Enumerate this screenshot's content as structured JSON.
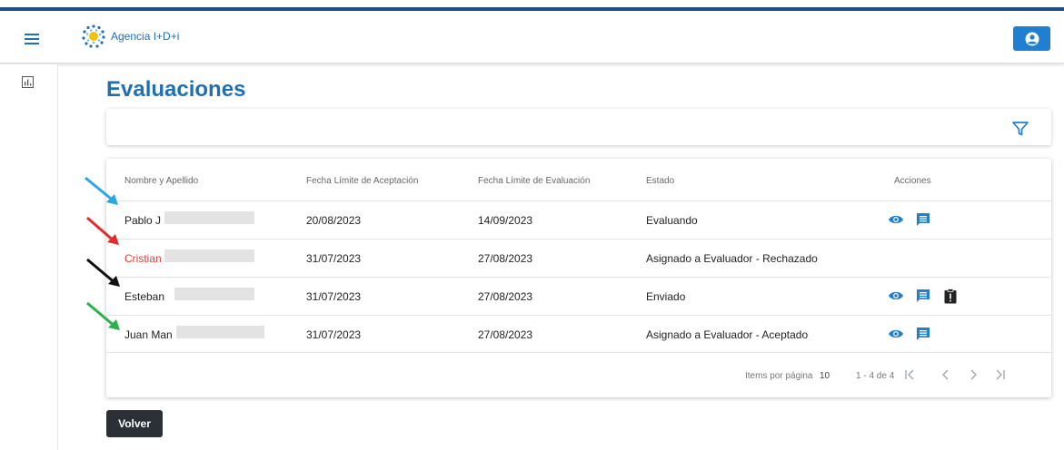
{
  "header": {
    "logo_text": "Agencia I+D+i",
    "menu_icon": "hamburger-menu-icon",
    "user_icon": "user-circle-icon",
    "accent": "#1f6fb5"
  },
  "sidebar": {
    "items": [
      {
        "icon": "bar-chart-icon"
      }
    ]
  },
  "page": {
    "title": "Evaluaciones"
  },
  "filter": {
    "icon": "filter-icon"
  },
  "table": {
    "headers": {
      "name": "Nombre y Apellido",
      "accept_deadline": "Fecha Límite de Aceptación",
      "eval_deadline": "Fecha Límite de Evaluación",
      "status": "Estado",
      "actions": "Acciones"
    },
    "rows": [
      {
        "name": "Pablo J",
        "accept_deadline": "20/08/2023",
        "eval_deadline": "14/09/2023",
        "status": "Evaluando",
        "name_color": "#222222",
        "actions": [
          "eye-icon",
          "comment-icon"
        ]
      },
      {
        "name": "Cristian",
        "accept_deadline": "31/07/2023",
        "eval_deadline": "27/08/2023",
        "status": "Asignado a Evaluador - Rechazado",
        "name_color": "#e53935",
        "actions": []
      },
      {
        "name": "Esteban",
        "accept_deadline": "31/07/2023",
        "eval_deadline": "27/08/2023",
        "status": "Enviado",
        "name_color": "#222222",
        "actions": [
          "eye-icon",
          "comment-icon",
          "clipboard-alert-icon"
        ]
      },
      {
        "name": "Juan Man",
        "accept_deadline": "31/07/2023",
        "eval_deadline": "27/08/2023",
        "status": "Asignado a Evaluador - Aceptado",
        "name_color": "#222222",
        "actions": [
          "eye-icon",
          "comment-icon"
        ]
      }
    ]
  },
  "pagination": {
    "items_per_page_label": "Items por página",
    "items_per_page_value": "10",
    "range": "1 - 4 de 4",
    "first_icon": "first-page-icon",
    "prev_icon": "chevron-left-icon",
    "next_icon": "chevron-right-icon",
    "last_icon": "last-page-icon"
  },
  "back_button": {
    "label": "Volver"
  },
  "annotations": {
    "arrow_colors": [
      "#29a8e0",
      "#e52b2b",
      "#111111",
      "#2bb24c"
    ]
  }
}
